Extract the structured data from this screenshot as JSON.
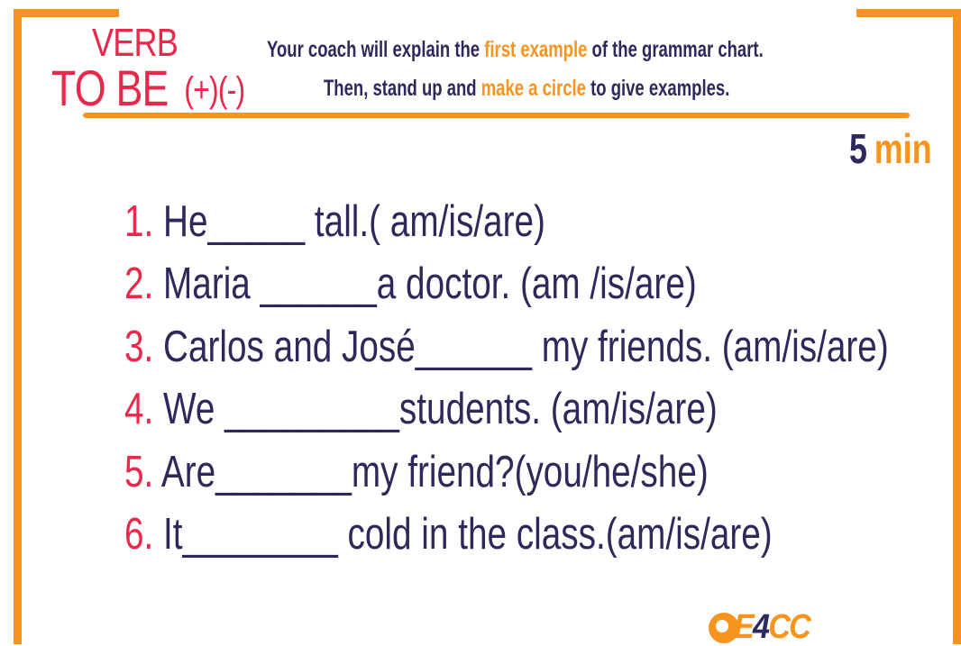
{
  "colors": {
    "accent": "#f7941d",
    "title": "#e8294c",
    "text": "#2d2a5b"
  },
  "title": {
    "line1": "VERB",
    "line2": "TO BE",
    "signs": "(+)(-)"
  },
  "instructions": {
    "line1": {
      "a": "Your coach will explain the ",
      "highlight": "first example",
      "b": " of the grammar chart."
    },
    "line2": {
      "a": "Then, stand up and ",
      "highlight": "make a circle",
      "b": " to give examples."
    }
  },
  "timer": {
    "value": "5",
    "unit": "min"
  },
  "exercises": [
    {
      "num": "1.",
      "text": " He_____ tall.( am/is/are)"
    },
    {
      "num": "2.",
      "text": " Maria ______a doctor. (am /is/are)"
    },
    {
      "num": "3.",
      "text": " Carlos and José______ my friends. (am/is/are)"
    },
    {
      "num": "4.",
      "text": " We _________students. (am/is/are)"
    },
    {
      "num": "5.",
      "text": " Are_______my friend?(you/he/she)"
    },
    {
      "num": "6.",
      "text": " It________ cold in the class.(am/is/are)"
    }
  ],
  "logo": {
    "text_a": "E",
    "text_b": "4",
    "text_c": "CC"
  }
}
